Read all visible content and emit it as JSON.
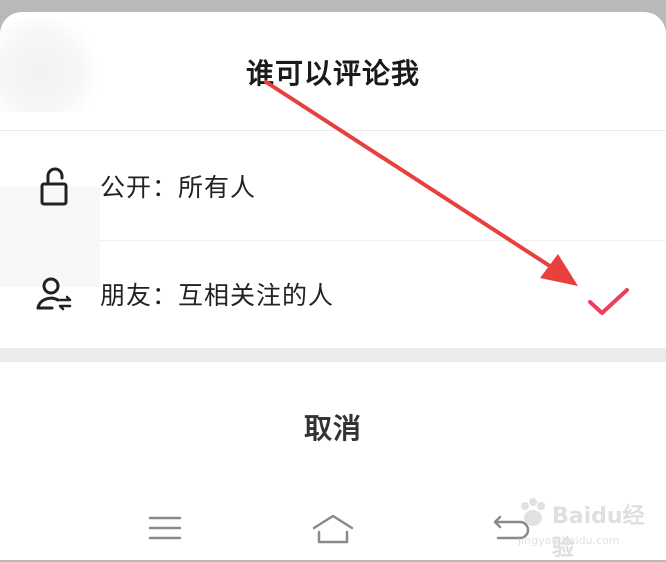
{
  "sheet": {
    "title": "谁可以评论我",
    "options": [
      {
        "label": "公开：所有人",
        "icon": "unlock-icon",
        "selected": false
      },
      {
        "label": "朋友：互相关注的人",
        "icon": "mutual-follow-icon",
        "selected": true
      }
    ],
    "check_color": "#ee3d63",
    "cancel_label": "取消"
  },
  "navbar": {
    "menu_icon": "menu-icon",
    "home_icon": "home-icon",
    "back_icon": "back-icon"
  },
  "annotation": {
    "arrow_color": "#e8403f"
  },
  "watermark": {
    "text": "Baidu经验",
    "sub": "jingyan.baidu.com"
  }
}
